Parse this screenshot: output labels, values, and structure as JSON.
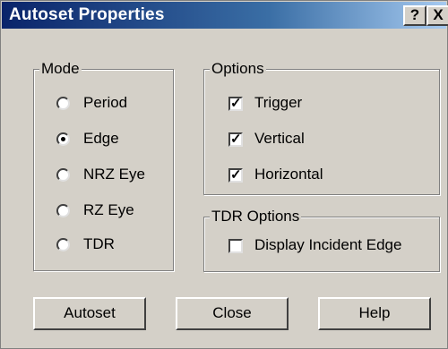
{
  "window": {
    "title": "Autoset Properties",
    "help_glyph": "?",
    "close_glyph": "X"
  },
  "mode_group": {
    "legend": "Mode",
    "options": [
      {
        "label": "Period",
        "selected": false
      },
      {
        "label": "Edge",
        "selected": true
      },
      {
        "label": "NRZ Eye",
        "selected": false
      },
      {
        "label": "RZ Eye",
        "selected": false
      },
      {
        "label": "TDR",
        "selected": false
      }
    ]
  },
  "options_group": {
    "legend": "Options",
    "items": [
      {
        "label": "Trigger",
        "checked": true
      },
      {
        "label": "Vertical",
        "checked": true
      },
      {
        "label": "Horizontal",
        "checked": true
      }
    ]
  },
  "tdr_group": {
    "legend": "TDR Options",
    "items": [
      {
        "label": "Display Incident Edge",
        "checked": false
      }
    ]
  },
  "buttons": {
    "autoset": "Autoset",
    "close": "Close",
    "help": "Help"
  }
}
